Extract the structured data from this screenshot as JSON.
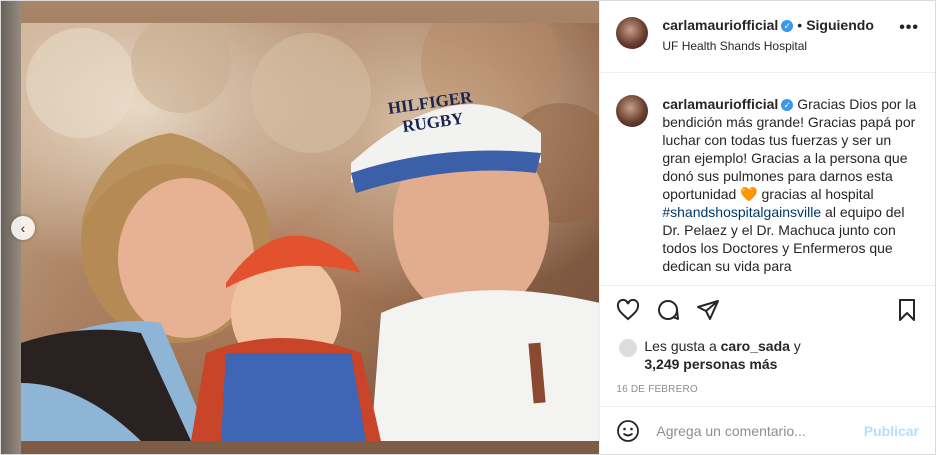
{
  "post": {
    "username": "carlamauriofficial",
    "verified": true,
    "separator": "•",
    "follow_status": "Siguiendo",
    "location": "UF Health Shands Hospital",
    "more_options": "•••"
  },
  "caption": {
    "username": "carlamauriofficial",
    "text_before_heart": "Gracias Dios por la bendición más grande! Gracias papá por luchar con todas tus fuerzas y ser un gran ejemplo! Gracias a la persona que donó sus pulmones para darnos esta oportunidad",
    "heart_emoji": "🧡",
    "text_after_heart": " gracias al hospital ",
    "hashtag": "#shandshospitalgainsville",
    "text_end": " al equipo del Dr. Pelaez y el Dr. Machuca junto con todos los Doctores y Enfermeros que dedican su vida para"
  },
  "photo": {
    "cap_text_line1": "HILFIGER",
    "cap_text_line2": "RUGBY"
  },
  "likes": {
    "prefix": "Les gusta a ",
    "user": "caro_sada",
    "conjunction": " y",
    "count": "3,249 personas más"
  },
  "date": "16 DE FEBRERO",
  "comment": {
    "placeholder": "Agrega un comentario...",
    "publish_label": "Publicar"
  },
  "icons": {
    "like": "heart-outline",
    "comment": "speech-bubble",
    "share": "paper-plane",
    "save": "bookmark",
    "emoji": "smiley",
    "prev": "chevron-left"
  },
  "colors": {
    "verified": "#3897f0",
    "hashtag": "#00376b",
    "publish_disabled": "#b2dffc",
    "secondary_text": "#8e8e8e"
  }
}
